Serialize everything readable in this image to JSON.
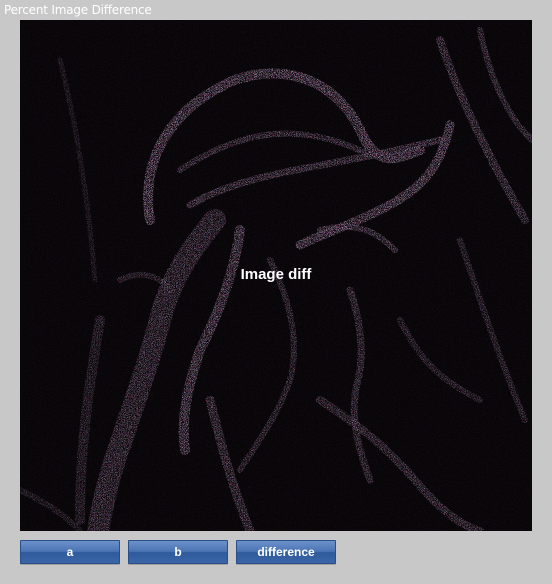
{
  "window": {
    "title": "Percent Image Difference"
  },
  "viewer": {
    "overlay_label": "Image diff"
  },
  "buttons": {
    "a": "a",
    "b": "b",
    "difference": "difference"
  },
  "colors": {
    "background": "#c8c8c8",
    "image_background": "#060406",
    "button": "#4b74b4",
    "text": "#ffffff"
  }
}
